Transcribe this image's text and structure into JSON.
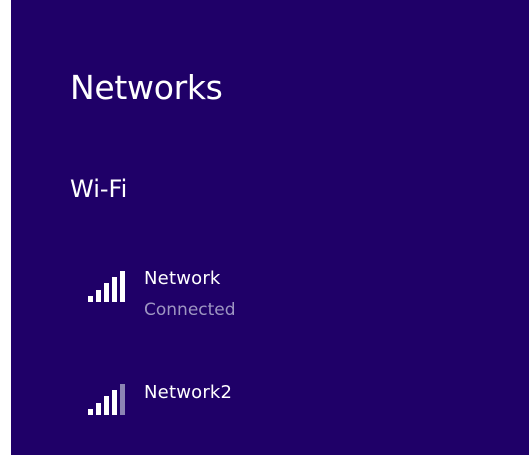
{
  "panel": {
    "title": "Networks",
    "section_label": "Wi-Fi",
    "background_color": "#1f0068",
    "networks": [
      {
        "name": "Network",
        "status": "Connected",
        "signal_bars": 5,
        "signal_bars_full": 5,
        "icon": "wifi-signal-icon"
      },
      {
        "name": "Network2",
        "signal_bars": 4,
        "signal_bars_full": 5,
        "icon": "wifi-signal-icon"
      }
    ]
  }
}
